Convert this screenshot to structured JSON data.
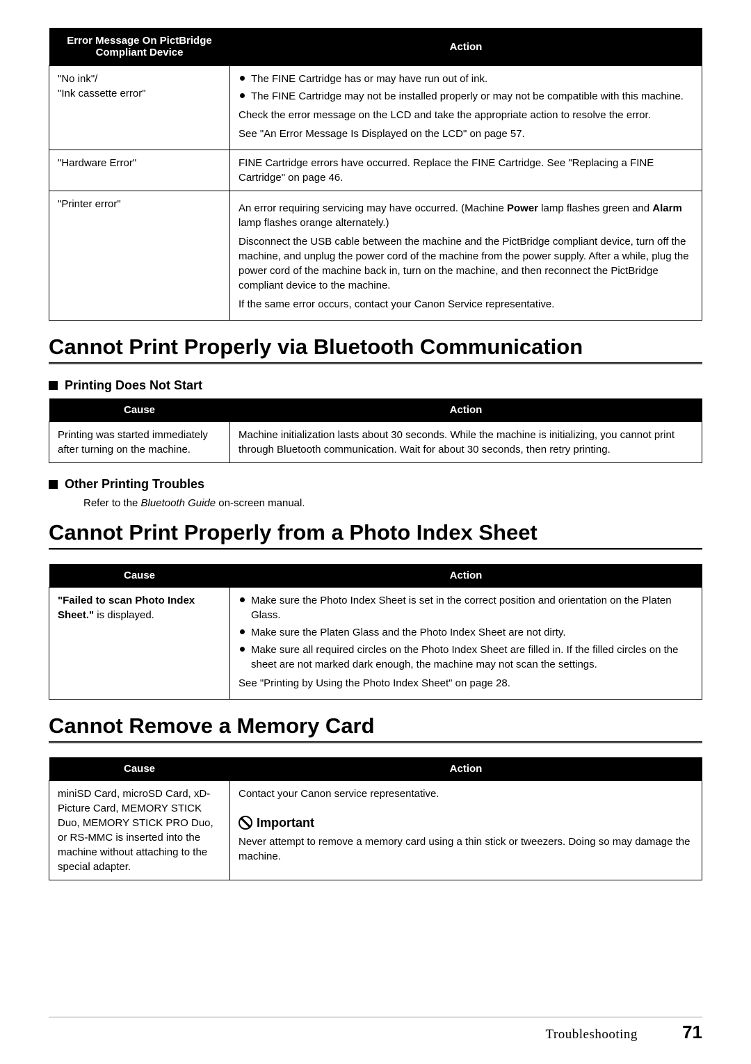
{
  "t1": {
    "h1": "Error Message On PictBridge Compliant Device",
    "h2": "Action",
    "r1c1a": "\"No ink\"/",
    "r1c1b": "\"Ink cassette error\"",
    "r1b1": "The FINE Cartridge has or may have run out of ink.",
    "r1b2": "The FINE Cartridge may not be installed properly or may not be compatible with this machine.",
    "r1p1": "Check the error message on the LCD and take the appropriate action to resolve the error.",
    "r1p2": "See \"An Error Message Is Displayed on the LCD\" on page 57.",
    "r2c1": "\"Hardware Error\"",
    "r2c2": "FINE Cartridge errors have occurred. Replace the FINE Cartridge. See \"Replacing a FINE Cartridge\" on page 46.",
    "r3c1": "\"Printer error\"",
    "r3p1a": "An error requiring servicing may have occurred. (Machine ",
    "r3p1b": "Power",
    "r3p1c": " lamp flashes green and ",
    "r3p1d": "Alarm",
    "r3p1e": " lamp flashes orange alternately.)",
    "r3p2": "Disconnect the USB cable between the machine and the PictBridge compliant device, turn off the machine, and unplug the power cord of the machine from the power supply. After a while, plug the power cord of the machine back in, turn on the machine, and then reconnect the PictBridge compliant device to the machine.",
    "r3p3": "If the same error occurs, contact your Canon Service representative."
  },
  "h2a": "Cannot Print Properly via Bluetooth Communication",
  "h3a": "Printing Does Not Start",
  "t2": {
    "h1": "Cause",
    "h2": "Action",
    "c1": "Printing was started immediately after turning on the machine.",
    "c2": "Machine initialization lasts about 30 seconds. While the machine is initializing, you cannot print through Bluetooth communication. Wait for about 30 seconds, then retry printing."
  },
  "h3b": "Other Printing Troubles",
  "refer1": "Refer to the ",
  "refer2": "Bluetooth Guide",
  "refer3": " on-screen manual.",
  "h2b": "Cannot Print Properly from a Photo Index Sheet",
  "t3": {
    "h1": "Cause",
    "h2": "Action",
    "c1a": "\"Failed to scan Photo Index Sheet.\"",
    "c1b": " is displayed.",
    "b1": "Make sure the Photo Index Sheet is set in the correct position and orientation on the Platen Glass.",
    "b2": "Make sure the Platen Glass and the Photo Index Sheet are not dirty.",
    "b3": "Make sure all required circles on the Photo Index Sheet are filled in. If the filled circles on the sheet are not marked dark enough, the machine may not scan the settings.",
    "p1": "See \"Printing by Using the Photo Index Sheet\" on page 28."
  },
  "h2c": "Cannot Remove a Memory Card",
  "t4": {
    "h1": "Cause",
    "h2": "Action",
    "c1": "miniSD Card, microSD Card, xD-Picture Card, MEMORY STICK Duo, MEMORY STICK PRO Duo, or RS-MMC is inserted into the machine without attaching to the special adapter.",
    "p1": "Contact your Canon service representative.",
    "imp": "Important",
    "p2": "Never attempt to remove a memory card using a thin stick or tweezers. Doing so may damage the machine."
  },
  "footer": {
    "label": "Troubleshooting",
    "num": "71"
  }
}
